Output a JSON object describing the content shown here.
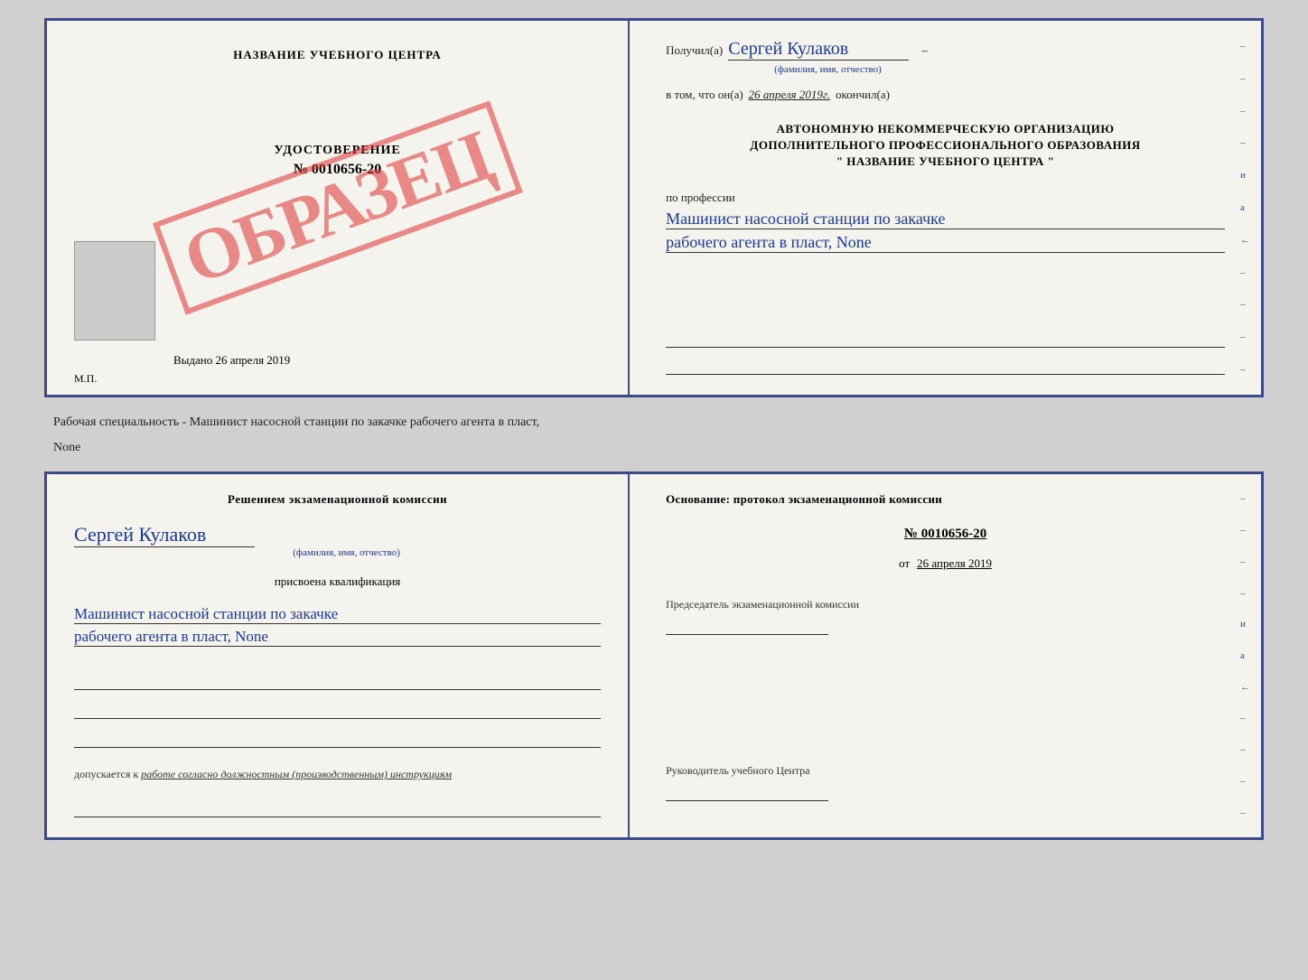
{
  "top_cert": {
    "left": {
      "title": "НАЗВАНИЕ УЧЕБНОГО ЦЕНТРА",
      "stamp": "ОБРАЗЕЦ",
      "udostoverenie_label": "УДОСТОВЕРЕНИЕ",
      "number": "№ 0010656-20",
      "vydano_label": "Выдано",
      "vydano_date": "26 апреля 2019",
      "mp": "М.П."
    },
    "right": {
      "poluchil_label": "Получил(а)",
      "poluchil_name": "Сергей Кулаков",
      "poluchil_sub": "(фамилия, имя, отчество)",
      "vtom_label": "в том, что он(а)",
      "vtom_date": "26 апреля 2019г.",
      "okonchil_label": "окончил(а)",
      "org_line1": "АВТОНОМНУЮ НЕКОММЕРЧЕСКУЮ ОРГАНИЗАЦИЮ",
      "org_line2": "ДОПОЛНИТЕЛЬНОГО ПРОФЕССИОНАЛЬНОГО ОБРАЗОВАНИЯ",
      "org_line3": "\"   НАЗВАНИЕ УЧЕБНОГО ЦЕНТРА   \"",
      "po_professii": "по профессии",
      "profession_line1": "Машинист насосной станции по закачке",
      "profession_line2": "рабочего агента в пласт, None"
    }
  },
  "specialty_text": "Рабочая специальность - Машинист насосной станции по закачке рабочего агента в пласт,",
  "specialty_text2": "None",
  "bottom_cert": {
    "left": {
      "decision_text": "Решением экзаменационной комиссии",
      "name": "Сергей Кулаков",
      "name_sub": "(фамилия, имя, отчество)",
      "prisvoena": "присвоена квалификация",
      "qualification_line1": "Машинист насосной станции по закачке",
      "qualification_line2": "рабочего агента в пласт, None",
      "dopuskaetsya_label": "допускается к",
      "dopuskaetsya_text": "работе согласно должностным (производственным) инструкциям"
    },
    "right": {
      "osnovanie_label": "Основание: протокол экзаменационной комиссии",
      "protocol_number": "№ 0010656-20",
      "ot_label": "от",
      "ot_date": "26 апреля 2019",
      "predsedatel_label": "Председатель экзаменационной комиссии",
      "rukovoditel_label": "Руководитель учебного Центра"
    }
  },
  "dashes": {
    "right_side": [
      "–",
      "–",
      "–",
      "–",
      "и",
      "а",
      "←",
      "–",
      "–",
      "–",
      "–"
    ]
  }
}
